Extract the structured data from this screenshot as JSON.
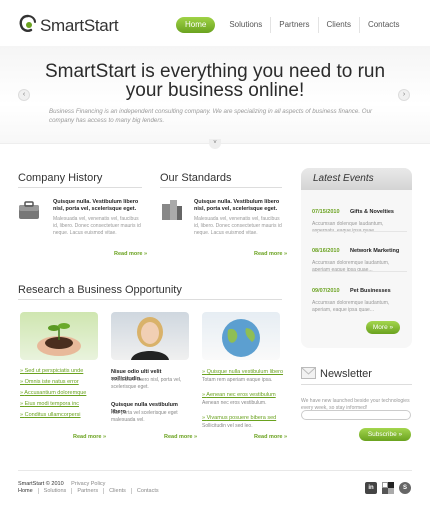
{
  "header": {
    "brand": "SmartStart",
    "nav": [
      "Home",
      "Solutions",
      "Partners",
      "Clients",
      "Contacts"
    ]
  },
  "slider": {
    "headline_line1": "SmartStart is everything you need to run",
    "headline_line2": "your business online!",
    "subtext": "Business Financing is an independent consulting company. We are specializing in all aspects of business finance. Our company has access to many big lenders."
  },
  "company_history": {
    "title": "Company History",
    "item_title": "Quisque nulla. Vestibulum libero nisl, porta vel, scelerisque eget.",
    "item_text": "Malesuada vel, venenatis vel, faucibus id, libero. Donec consectetuer mauris id neque. Lacus euismod vitae.",
    "readmore": "Read more"
  },
  "our_standards": {
    "title": "Our Standards",
    "item_title": "Quisque nulla. Vestibulum libero nisl, porta vel, scelerisque eget.",
    "item_text": "Malesuada vel, venenatis vel, faucibus id, libero. Donec consectetuer mauris id neque. Lacus euismod vitae.",
    "readmore": "Read more"
  },
  "events": {
    "title": "Latest Events",
    "items": [
      {
        "date": "07/15/2010",
        "title": "Gifts & Novelties",
        "text": "Accumsan dolenque laudantum, aspernatu. eaque ipsa quae..."
      },
      {
        "date": "08/16/2010",
        "title": "Network Marketing",
        "text": "Accumsan doloremque laudantum, aperiam eaque ipsa quae..."
      },
      {
        "date": "09/07/2010",
        "title": "Pet Businesses",
        "text": "Accumsan doloremque laudantum, aperiam, eaque ipsa quae..."
      }
    ],
    "more": "More"
  },
  "research": {
    "title": "Research a Business Opportunity",
    "list": [
      "Sed ut perspiciatis unde",
      "Omnis iste natus error",
      "Accusantium doloremque",
      "Eius modi tempora inc",
      "Conditus ullamcorpersi"
    ],
    "col2_title1": "Nisue odio ulti velit sollicitudin.",
    "col2_text1": "Vestibulum libero nisl, porta vel, scelerisque eget.",
    "col2_title2": "Quisque nulla vestibulum libero",
    "col2_text2": "Nisl porta vel scelerisque eget malesuada vel.",
    "col3_title1": "Quisque nulla vestibulum libero",
    "col3_text1": "Totam rem aperiam eaque ipsa.",
    "col3_title2": "Aenean nec eros vestibulum",
    "col3_text2": "Aenean nec eros vestibulum.",
    "col3_title3": "Vivamus posuere bibera sed",
    "col3_text3": "Sollicitudin vel sed leo.",
    "readmore": "Read more"
  },
  "newsletter": {
    "title": "Newsletter",
    "text": "We have new launched beside your technologies every week, so stay informed!",
    "placeholder": "",
    "button": "Subscribe"
  },
  "footer": {
    "brand": "SmartStart © 2010",
    "policy": "Privacy Policy",
    "links": [
      "Home",
      "Solutions",
      "Partners",
      "Clients",
      "Contacts"
    ],
    "social": [
      "linkedin-icon",
      "delicious-icon",
      "skype-icon"
    ]
  },
  "colors": {
    "accent": "#6aa21f"
  }
}
